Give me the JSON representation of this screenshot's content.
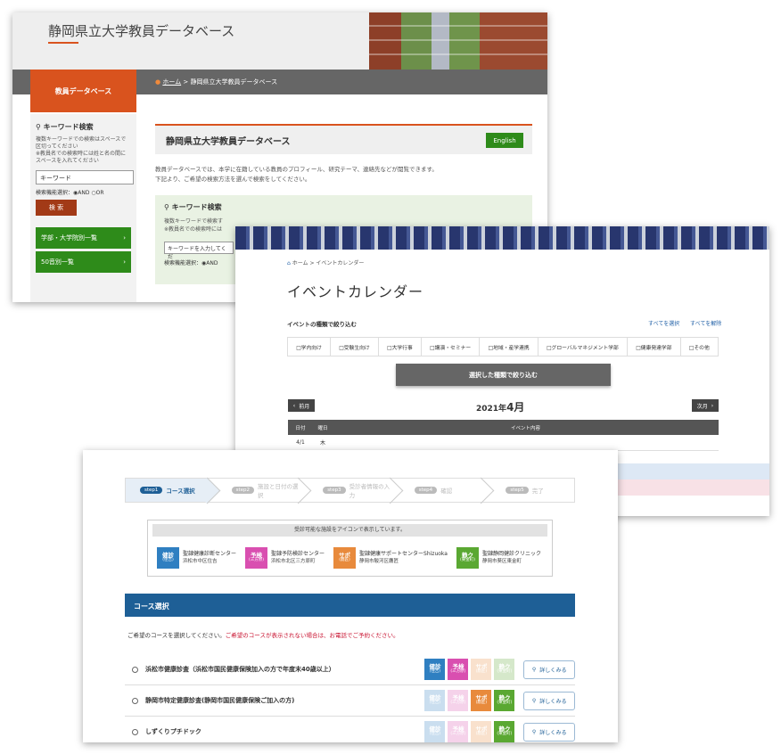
{
  "shot1": {
    "title": "静岡県立大学教員データベース",
    "side_title": "教員データベース",
    "breadcrumb_home": "ホーム",
    "breadcrumb_sep": " > ",
    "breadcrumb_current": "静岡県立大学教員データベース",
    "left": {
      "keyword_title": "キーワード検索",
      "keyword_desc1": "複数キーワードでの検索はスペースで区切ってください",
      "keyword_desc2": "※教員名での検索時には姓と名の間にスペースを入れてください",
      "keyword_value": "キーワード",
      "search_mode_label": "検索機能選択：",
      "and_label": "AND",
      "or_label": "OR",
      "search_button": "検 索",
      "link_faculty": "学部・大学院別一覧",
      "link_kana": "50音別一覧"
    },
    "main": {
      "heading": "静岡県立大学教員データベース",
      "english_button": "English",
      "desc1": "教員データベースでは、本学に在籍している教員のプロフィール、研究テーマ、連絡先などが閲覧できます。",
      "desc2": "下記より、ご希望の検索方法を選んで検索をしてください。",
      "kw_title": "キーワード検索",
      "kw_desc1": "複数キーワードで検索す",
      "kw_desc2": "※教員名での検索時には",
      "kw_placeholder": "キーワードを入力してくだ",
      "kw_mode": "検索機能選択：",
      "kw_and": "AND"
    }
  },
  "shot2": {
    "breadcrumb": "ホーム > イベントカレンダー",
    "heading": "イベントカレンダー",
    "filter_label": "イベントの種類で絞り込む",
    "select_all": "すべてを選択",
    "clear_all": "すべてを解除",
    "categories": [
      "□学内向け",
      "□受験生向け",
      "□大学行事",
      "□講演・セミナー",
      "□地域・産学連携",
      "□グローバルマネジメント学部",
      "□健康発達学部",
      "□その他"
    ],
    "filter_button": "選択した種類で絞り込む",
    "prev": "前月",
    "next": "次月",
    "year": "2021年",
    "month": "4月",
    "columns": [
      "日付",
      "曜日",
      "イベント内容"
    ],
    "rows": [
      {
        "date": "4/1",
        "day": "木",
        "content": ""
      }
    ]
  },
  "shot3": {
    "steps": [
      {
        "pill": "step1",
        "label": "コース選択",
        "active": true
      },
      {
        "pill": "step2",
        "label": "施設と日付の選択",
        "active": false
      },
      {
        "pill": "step3",
        "label": "受診者情報の入力",
        "active": false
      },
      {
        "pill": "step4",
        "label": "確認",
        "active": false
      },
      {
        "pill": "step5",
        "label": "完了",
        "active": false
      }
    ],
    "facility_note": "受診可能な施設をアイコンで表示しています。",
    "facilities": [
      {
        "icon": "健診",
        "sub": "(住吉)",
        "color": "#2f7fc1",
        "name": "聖隷健康診断センター",
        "addr": "浜松市中区住吉"
      },
      {
        "icon": "予検",
        "sub": "(三方原)",
        "color": "#d94fb0",
        "name": "聖隷予防検診センター",
        "addr": "浜松市北区三方原町"
      },
      {
        "icon": "サポ",
        "sub": "(鷹匠)",
        "color": "#e88a3c",
        "name": "聖隷健康サポートセンターShizuoka",
        "addr": "静岡市駿河区鷹匠"
      },
      {
        "icon": "静ク",
        "sub": "(東金町)",
        "color": "#5aa832",
        "name": "聖隷静岡健診クリニック",
        "addr": "静岡市葵区東金町"
      }
    ],
    "section_title": "コース選択",
    "lead": "ご希望のコースを選択してください。",
    "lead_red": "ご希望のコースが表示されない場合は、お電話でご予約ください。",
    "detail_label": "詳しくみる",
    "courses": [
      {
        "name": "浜松市健康診査（浜松市国民健康保険加入の方で年度末40歳以上）",
        "avail": [
          true,
          true,
          false,
          false
        ]
      },
      {
        "name": "静岡市特定健康診査(静岡市国民健康保険ご加入の方)",
        "avail": [
          false,
          false,
          true,
          true
        ]
      },
      {
        "name": "しずくりプチドック",
        "avail": [
          false,
          false,
          false,
          true
        ]
      }
    ]
  }
}
